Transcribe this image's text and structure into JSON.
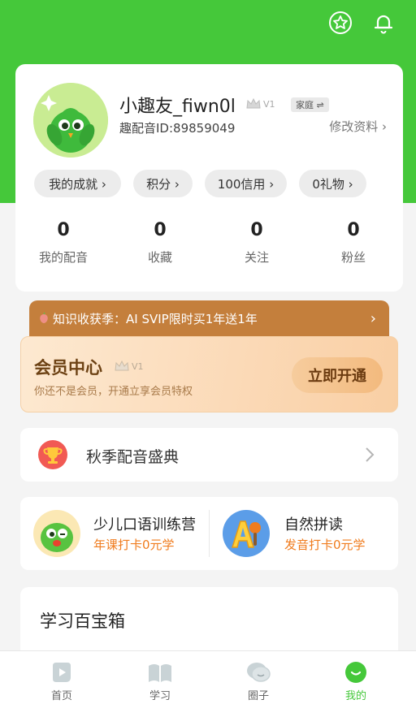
{
  "profile": {
    "username": "小趣友_fiwn0l",
    "vip_level": "V1",
    "family_label": "家庭 ⇌",
    "user_id": "趣配音ID:89859049",
    "edit_link": "修改资料 ›",
    "pills": [
      {
        "label": "我的成就 ›"
      },
      {
        "label": "积分 ›"
      },
      {
        "label": "100信用 ›"
      },
      {
        "label": "0礼物 ›"
      }
    ],
    "stats": [
      {
        "value": "0",
        "label": "我的配音"
      },
      {
        "value": "0",
        "label": "收藏"
      },
      {
        "value": "0",
        "label": "关注"
      },
      {
        "value": "0",
        "label": "粉丝"
      }
    ]
  },
  "promo": {
    "text": "知识收获季：AI SVIP限时买1年送1年",
    "arrow": "›"
  },
  "member": {
    "title": "会员中心",
    "vip_level": "V1",
    "subtitle": "你还不是会员，开通立享会员特权",
    "button": "立即开通"
  },
  "festival": {
    "label": "秋季配音盛典"
  },
  "courses": [
    {
      "title": "少儿口语训练营",
      "subtitle": "年课打卡0元学"
    },
    {
      "title": "自然拼读",
      "subtitle": "发音打卡0元学"
    }
  ],
  "toolbox": {
    "title": "学习百宝箱"
  },
  "nav": [
    {
      "label": "首页"
    },
    {
      "label": "学习"
    },
    {
      "label": "圈子"
    },
    {
      "label": "我的"
    }
  ],
  "colors": {
    "brand_green": "#45c83a",
    "accent_orange": "#f07c1e",
    "promo_brown": "#c47f3c"
  }
}
